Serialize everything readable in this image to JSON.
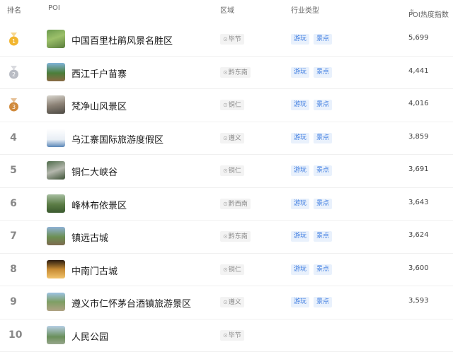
{
  "header": {
    "rank": "排名",
    "poi": "POI",
    "area": "区域",
    "industry": "行业类型",
    "heat": "POI热度指数"
  },
  "rows": [
    {
      "rank": "1",
      "name": "中国百里杜鹃风景名胜区",
      "area": "毕节",
      "tags": [
        "游玩",
        "景点"
      ],
      "heat": "5,699",
      "medal": "gold"
    },
    {
      "rank": "2",
      "name": "西江千户苗寨",
      "area": "黔东南",
      "tags": [
        "游玩",
        "景点"
      ],
      "heat": "4,441",
      "medal": "silver"
    },
    {
      "rank": "3",
      "name": "梵净山风景区",
      "area": "铜仁",
      "tags": [
        "游玩",
        "景点"
      ],
      "heat": "4,016",
      "medal": "bronze"
    },
    {
      "rank": "4",
      "name": "乌江寨国际旅游度假区",
      "area": "遵义",
      "tags": [
        "游玩",
        "景点"
      ],
      "heat": "3,859"
    },
    {
      "rank": "5",
      "name": "铜仁大峡谷",
      "area": "铜仁",
      "tags": [
        "游玩",
        "景点"
      ],
      "heat": "3,691"
    },
    {
      "rank": "6",
      "name": "峰林布依景区",
      "area": "黔西南",
      "tags": [
        "游玩",
        "景点"
      ],
      "heat": "3,643"
    },
    {
      "rank": "7",
      "name": "镇远古城",
      "area": "黔东南",
      "tags": [
        "游玩",
        "景点"
      ],
      "heat": "3,624"
    },
    {
      "rank": "8",
      "name": "中南门古城",
      "area": "铜仁",
      "tags": [
        "游玩",
        "景点"
      ],
      "heat": "3,600"
    },
    {
      "rank": "9",
      "name": "遵义市仁怀茅台酒镇旅游景区",
      "area": "遵义",
      "tags": [
        "游玩",
        "景点"
      ],
      "heat": "3,593"
    },
    {
      "rank": "10",
      "name": "人民公园",
      "area": "毕节",
      "tags": [],
      "heat": ""
    }
  ],
  "colors": {
    "gold": "#f2b630",
    "silver": "#b9bcc4",
    "bronze": "#d08a3c",
    "tag_bg": "#e9f1fc",
    "tag_text": "#3c7be0"
  },
  "icons": {
    "sort": "sort-icon",
    "location": "location-pin-icon",
    "medal": "medal-icon"
  }
}
